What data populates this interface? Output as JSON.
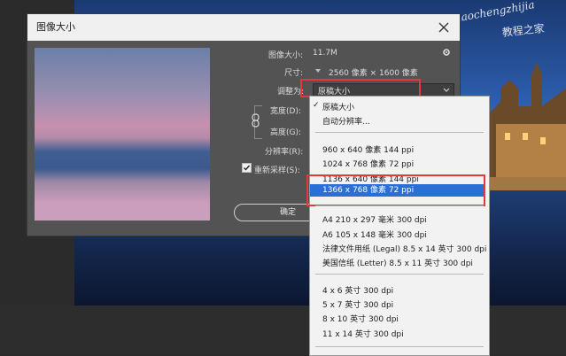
{
  "watermark": {
    "line1": "jiaochengzhijia",
    "line2": "教程之家"
  },
  "dialog": {
    "title": "图像大小",
    "image_size_label": "图像大小:",
    "image_size_value": "11.7M",
    "dimensions_label": "尺寸:",
    "dimensions_value": "2560 像素 × 1600 像素",
    "fit_to_label": "调整为:",
    "fit_to_selected": "原稿大小",
    "width_label": "宽度(D):",
    "height_label": "高度(G):",
    "resolution_label": "分辨率(R):",
    "resample_label": "重新采样(S):",
    "resample_checked": true,
    "ok_label": "确定"
  },
  "menu": {
    "checked_item": "原稿大小",
    "auto_item": "自动分辨率...",
    "group1": [
      "960 x 640 像素 144 ppi",
      "1024 x 768 像素 72 ppi",
      "1136 x 640 像素 144 ppi"
    ],
    "selected_item": "1366 x 768 像素 72 ppi",
    "group2": [
      "A4 210 x 297 毫米 300 dpi",
      "A6 105 x 148 毫米 300 dpi",
      "法律文件用纸 (Legal) 8.5 x 14 英寸 300 dpi",
      "美国信纸 (Letter) 8.5 x 11 英寸 300 dpi"
    ],
    "group3": [
      "4 x 6 英寸 300 dpi",
      "5 x 7 英寸 300 dpi",
      "8 x 10 英寸 300 dpi",
      "11 x 14 英寸 300 dpi"
    ]
  },
  "colors": {
    "highlight": "#e23a3a",
    "selection": "#2a6fd6"
  }
}
